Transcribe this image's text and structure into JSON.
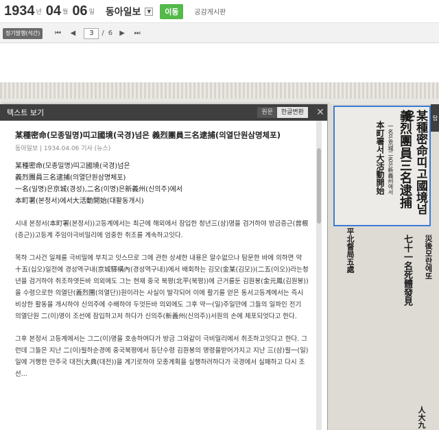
{
  "header": {
    "year": "1934",
    "year_unit": "년",
    "month": "04",
    "month_unit": "월",
    "day": "06",
    "day_unit": "일",
    "paper": "동아일보",
    "go_label": "이동",
    "board_label": "공감게시판"
  },
  "pagebar": {
    "badge": "정기발행(석간)",
    "current_page": "3",
    "total_pages": "6",
    "separator": "/"
  },
  "panel": {
    "title": "텍스트 보기",
    "btn_original": "원문",
    "btn_convert": "한글변환",
    "article_title": "某種密命(모종밀명)띠고國境(국경)넘은 義烈團員三名逮捕(의열단원삼명체포)",
    "meta": "동아일보 | 1934.04.06 기사 (뉴스)",
    "headline_lines": [
      "某種密命(모종밀명)띠고國境(국경)넘은",
      "義烈團員三名逮捕(의열단원삼명체포)",
      "一名(일명)은京城(경성),二名(이명)은新義州(신의주)에서",
      "本町署(본정서)에서大活動開始(대활동개시)"
    ],
    "para1": "시내 본정서(本町署(본정서))고등계에서는 최근에 해외에서 잠입한 청년三(삼)명을 검거하야 방금증근(曾根(증근))고등계 주임이극비밀리에 엄중한 취조를 계속하고잇다.",
    "para2": "목하 그사건 일체를 극비밀에 부치고 잇스므로 그에 관한 상세한 내용은 알수없으나 탐문한 바에 의하면 약 十五(십오)일전에 경성역구내(京城驛構內(경성역구내))에서 배회하는 김모(金某(김모))(二五(이오))라는청년을 검거하야 취조하엿든바 의외에도 그는 현재 중국 북평(北平(북평))에 근거를둔 김원봉(金元鳳(김원봉))을 수령으로한 의열단(義烈團(의열단))원이라는 사실이 발각되어 이에 활기를 얻은 동서고등계에서는 즉시 비상한 활동을 개시하야 신의주에 수배하야 두엇든바 의외에도 그후 약一(일)주일만에 그들의 일파인 전기 의열단원 二(이)명이 조선에 잠입하고저 하다가 신의주(新義州(신의주))서원의 손에 체포되엇다고 한다.",
    "para3": "그후 본정서 고등계에서는 그二(이)명을 호송하여다가 방금 그와같이 극비밀리에서 취조하고잇다고 한다. 그런데 그들은 지난 二(이)월하순경에 중국북평에서 등단수령 김원봉의 명령을받어가지고 지난 三(삼)월一(일)일에 거행한 만주국 대전(大典(대전))을 계기로하야 모종계획을 실행하려하다가 국경에서 실패하고 다시 조선..."
  },
  "newspaper": {
    "head1": "某種密命띠고國境넘은",
    "head2": "義烈團員三名逮捕",
    "head3": "一名은京城二名은新義州에서",
    "head4": "本町署서大活動開始",
    "sub1": "平北督局五處",
    "sub2": "七十一名死體發見",
    "sub3": "災後모란에또",
    "sub4": "人大九",
    "side_tab": "탑"
  }
}
